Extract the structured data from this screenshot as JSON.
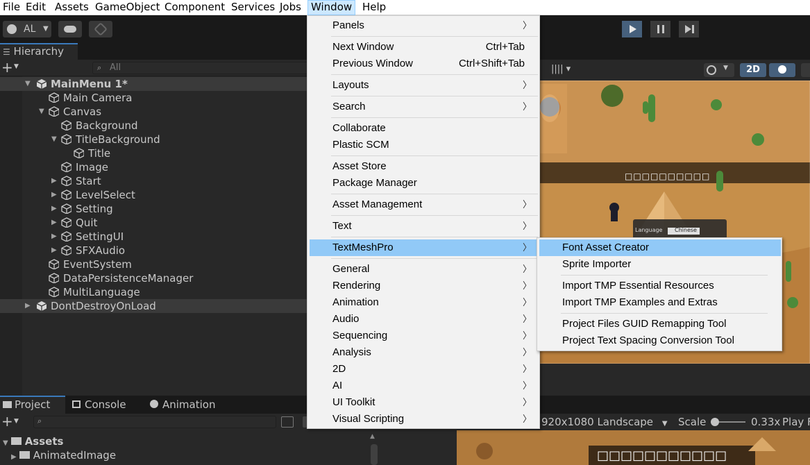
{
  "menubar": {
    "items": [
      "File",
      "Edit",
      "Assets",
      "GameObject",
      "Component",
      "Services",
      "Jobs",
      "Window",
      "Help"
    ],
    "active": "Window"
  },
  "toolbar": {
    "account_label": "AL"
  },
  "hierarchy": {
    "tab_label": "Hierarchy",
    "search_placeholder": "All",
    "rows": [
      {
        "label": "MainMenu 1*",
        "depth": 0,
        "type": "scene",
        "expanded": true
      },
      {
        "label": "Main Camera",
        "depth": 1,
        "type": "object"
      },
      {
        "label": "Canvas",
        "depth": 1,
        "type": "object",
        "expanded": true
      },
      {
        "label": "Background",
        "depth": 2,
        "type": "object"
      },
      {
        "label": "TitleBackground",
        "depth": 2,
        "type": "object",
        "expanded": true
      },
      {
        "label": "Title",
        "depth": 3,
        "type": "object"
      },
      {
        "label": "Image",
        "depth": 2,
        "type": "object"
      },
      {
        "label": "Start",
        "depth": 2,
        "type": "object",
        "collapsed": true
      },
      {
        "label": "LevelSelect",
        "depth": 2,
        "type": "object",
        "collapsed": true
      },
      {
        "label": "Setting",
        "depth": 2,
        "type": "object",
        "collapsed": true
      },
      {
        "label": "Quit",
        "depth": 2,
        "type": "object",
        "collapsed": true
      },
      {
        "label": "SettingUI",
        "depth": 2,
        "type": "object",
        "collapsed": true
      },
      {
        "label": "SFXAudio",
        "depth": 2,
        "type": "object",
        "collapsed": true
      },
      {
        "label": "EventSystem",
        "depth": 1,
        "type": "object"
      },
      {
        "label": "DataPersistenceManager",
        "depth": 1,
        "type": "object"
      },
      {
        "label": "MultiLanguage",
        "depth": 1,
        "type": "object"
      },
      {
        "label": "DontDestroyOnLoad",
        "depth": 0,
        "type": "scene2",
        "collapsed": true
      }
    ]
  },
  "scene": {
    "mode_2d": "2D",
    "title_boxes": "□□□□□□□□□□",
    "language_label": "Language",
    "language_value": "Chinese"
  },
  "bottom": {
    "tabs": [
      "Project",
      "Console",
      "Animation"
    ],
    "active_tab": "Project",
    "assets_root": "Assets",
    "assets_child": "AnimatedImage"
  },
  "game": {
    "resolution": "920x1080 Landscape",
    "scale_label": "Scale",
    "scale_value": "0.33x",
    "play_label": "Play F",
    "title_boxes": "□□□□□□□□□□□"
  },
  "window_menu": {
    "items": [
      {
        "label": "Panels",
        "submenu": true,
        "sep_after": true
      },
      {
        "label": "Next Window",
        "shortcut": "Ctrl+Tab"
      },
      {
        "label": "Previous Window",
        "shortcut": "Ctrl+Shift+Tab",
        "sep_after": true
      },
      {
        "label": "Layouts",
        "submenu": true,
        "sep_after": true
      },
      {
        "label": "Search",
        "submenu": true,
        "sep_after": true
      },
      {
        "label": "Collaborate"
      },
      {
        "label": "Plastic SCM",
        "sep_after": true
      },
      {
        "label": "Asset Store"
      },
      {
        "label": "Package Manager",
        "sep_after": true
      },
      {
        "label": "Asset Management",
        "submenu": true,
        "sep_after": true
      },
      {
        "label": "Text",
        "submenu": true,
        "sep_after": true
      },
      {
        "label": "TextMeshPro",
        "submenu": true,
        "highlighted": true,
        "sep_after": true
      },
      {
        "label": "General",
        "submenu": true
      },
      {
        "label": "Rendering",
        "submenu": true
      },
      {
        "label": "Animation",
        "submenu": true
      },
      {
        "label": "Audio",
        "submenu": true
      },
      {
        "label": "Sequencing",
        "submenu": true
      },
      {
        "label": "Analysis",
        "submenu": true
      },
      {
        "label": "2D",
        "submenu": true
      },
      {
        "label": "AI",
        "submenu": true
      },
      {
        "label": "UI Toolkit",
        "submenu": true
      },
      {
        "label": "Visual Scripting",
        "submenu": true
      }
    ]
  },
  "tmp_menu": {
    "items": [
      {
        "label": "Font Asset Creator",
        "highlighted": true
      },
      {
        "label": "Sprite Importer",
        "sep_after": true
      },
      {
        "label": "Import TMP Essential Resources"
      },
      {
        "label": "Import TMP Examples and Extras",
        "sep_after": true
      },
      {
        "label": "Project Files GUID Remapping Tool"
      },
      {
        "label": "Project Text Spacing Conversion Tool"
      }
    ]
  },
  "colors": {
    "accent": "#3a79bb",
    "menu_highlight": "#91c9f7",
    "panel_bg": "#282828",
    "sand": "#c68f4a"
  }
}
